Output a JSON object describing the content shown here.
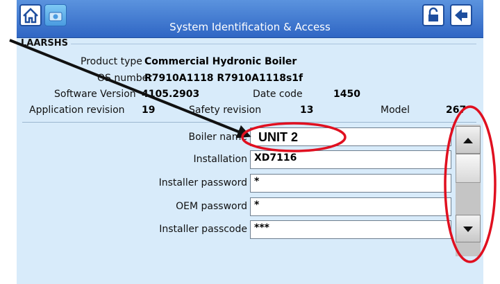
{
  "header": {
    "title": "System Identification & Access",
    "icons": [
      "home-icon",
      "camera-icon",
      "lock-icon",
      "back-arrow-icon"
    ]
  },
  "panel": {
    "name": "LAARSHS"
  },
  "info": {
    "product_type_label": "Product type",
    "product_type_value": "Commercial Hydronic Boiler",
    "os_number_label": "OS number",
    "os_number_value": "R7910A1118 R7910A1118s1f",
    "software_version_label": "Software Version",
    "software_version_value": "4105.2903",
    "date_code_label": "Date code",
    "date_code_value": "1450",
    "application_revision_label": "Application revision",
    "application_revision_value": "19",
    "safety_revision_label": "Safety revision",
    "safety_revision_value": "13",
    "model_label": "Model",
    "model_value": "267"
  },
  "form": {
    "boiler_name_label": "Boiler name",
    "boiler_name_value": "",
    "installation_label": "Installation",
    "installation_value": "XD7116",
    "installer_password_label": "Installer password",
    "installer_password_value": "*",
    "oem_password_label": "OEM password",
    "oem_password_value": "*",
    "installer_passcode_label": "Installer passcode",
    "installer_passcode_value": "***"
  },
  "annotation": {
    "callout_text": "UNIT 2",
    "highlight_color": "#e01020",
    "arrow_color": "#111111"
  },
  "colors": {
    "titlebar": "#2f66c4",
    "background": "#d8ebfa"
  }
}
